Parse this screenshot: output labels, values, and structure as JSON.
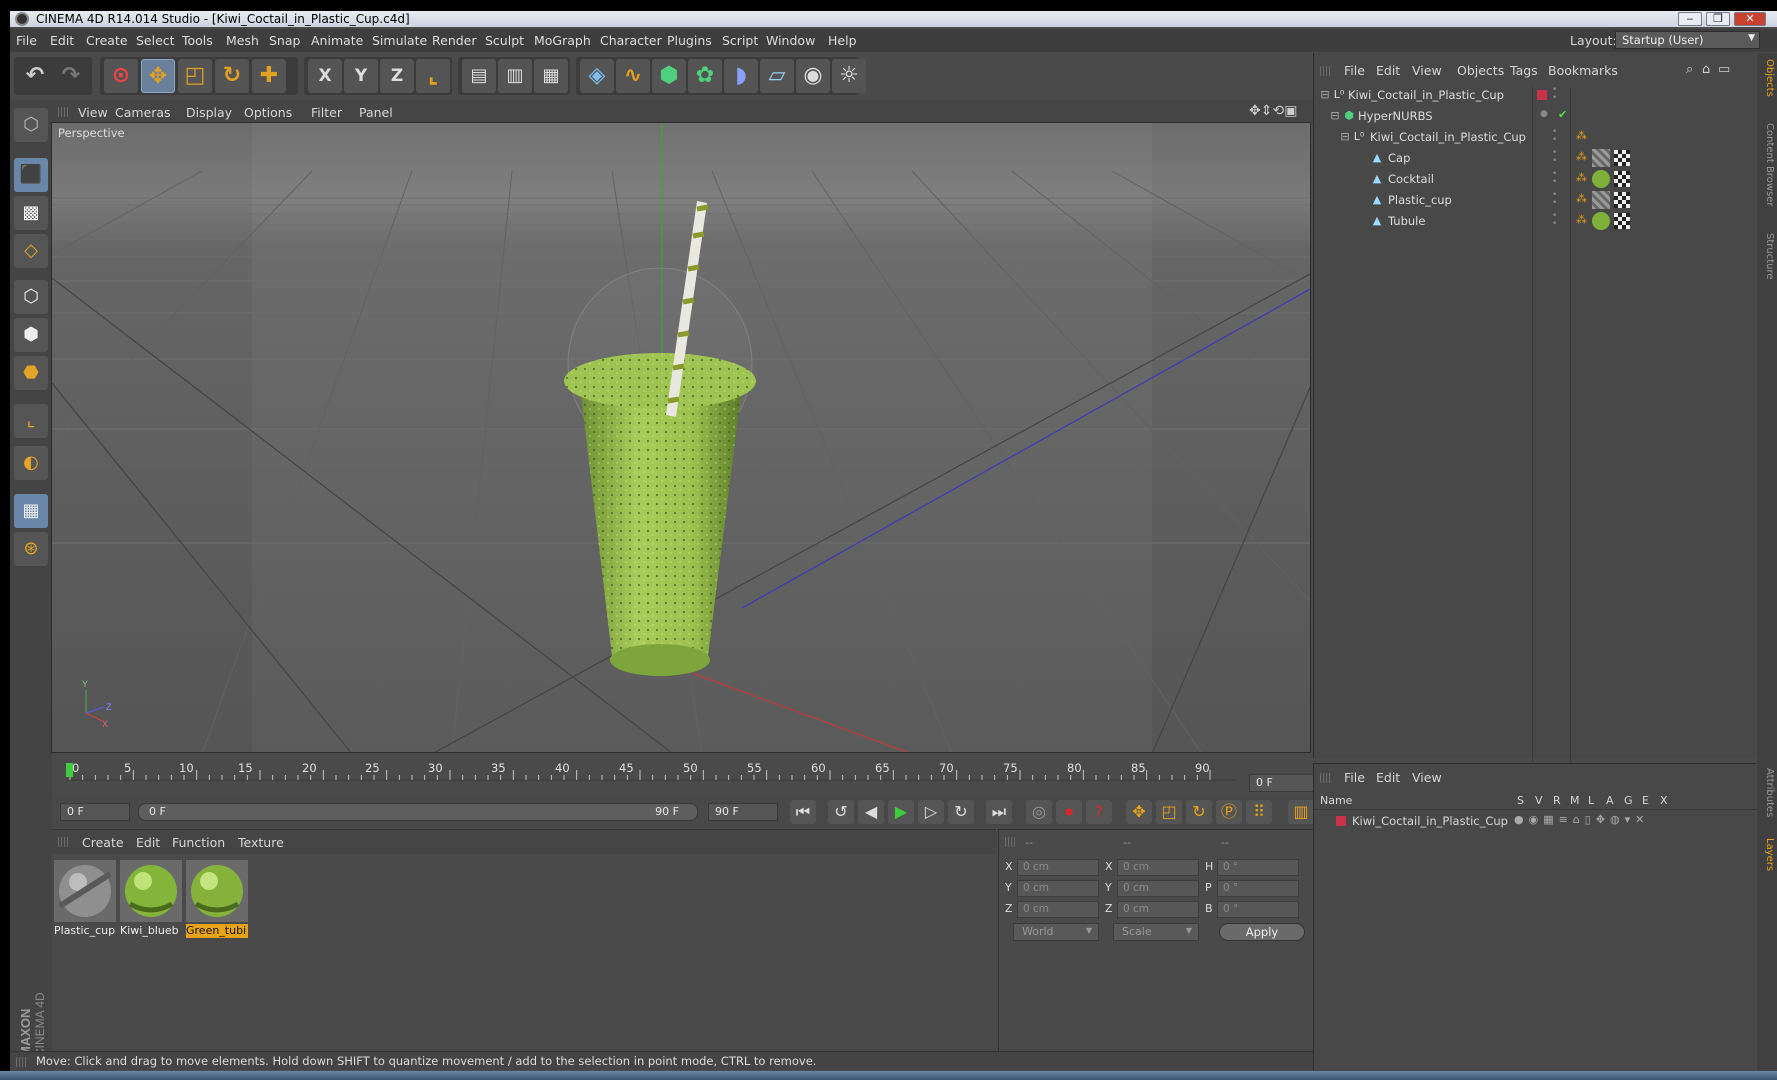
{
  "window": {
    "title": "CINEMA 4D R14.014 Studio - [Kiwi_Coctail_in_Plastic_Cup.c4d]",
    "minimize": "‒",
    "restore": "❐",
    "close": "✕"
  },
  "menubar": {
    "items": [
      "File",
      "Edit",
      "Create",
      "Select",
      "Tools",
      "Mesh",
      "Snap",
      "Animate",
      "Simulate",
      "Render",
      "Sculpt",
      "MoGraph",
      "Character",
      "Plugins",
      "Script",
      "Window",
      "Help"
    ],
    "layout_label": "Layout:",
    "layout_value": "Startup (User)"
  },
  "toolbar": {
    "undo_icon": "undo-icon",
    "redo_icon": "redo-icon",
    "axis_x": "X",
    "axis_y": "Y",
    "axis_z": "Z"
  },
  "viewport": {
    "menu": [
      "View",
      "Cameras",
      "Display",
      "Options",
      "Filter",
      "Panel"
    ],
    "label": "Perspective",
    "axis_y": "Y",
    "axis_z": "Z",
    "axis_x": "X"
  },
  "timeline": {
    "ticks": [
      "0",
      "5",
      "10",
      "15",
      "20",
      "25",
      "30",
      "35",
      "40",
      "45",
      "50",
      "55",
      "60",
      "65",
      "70",
      "75",
      "80",
      "85",
      "90"
    ],
    "current_frame": "0 F",
    "start_frame": "0 F",
    "range_start": "0 F",
    "range_end": "90 F",
    "end_frame": "90 F"
  },
  "material_manager": {
    "menu": [
      "Create",
      "Edit",
      "Function",
      "Texture"
    ],
    "materials": [
      {
        "name": "Plastic_cup",
        "selected": false
      },
      {
        "name": "Kiwi_blueb",
        "selected": false
      },
      {
        "name": "Green_tubi",
        "selected": true
      }
    ]
  },
  "coordinates": {
    "header_a": "--",
    "header_b": "--",
    "header_c": "--",
    "rows": [
      {
        "l1": "X",
        "v1": "0 cm",
        "l2": "X",
        "v2": "0 cm",
        "l3": "H",
        "v3": "0 °"
      },
      {
        "l1": "Y",
        "v1": "0 cm",
        "l2": "Y",
        "v2": "0 cm",
        "l3": "P",
        "v3": "0 °"
      },
      {
        "l1": "Z",
        "v1": "0 cm",
        "l2": "Z",
        "v2": "0 cm",
        "l3": "B",
        "v3": "0 °"
      }
    ],
    "world": "World",
    "scale": "Scale",
    "apply": "Apply"
  },
  "object_manager": {
    "menu": [
      "File",
      "Edit",
      "View",
      "Objects",
      "Tags",
      "Bookmarks"
    ],
    "objects": [
      {
        "name": "Kiwi_Coctail_in_Plastic_Cup",
        "indent": 0,
        "icon": "null-icon"
      },
      {
        "name": "HyperNURBS",
        "indent": 1,
        "icon": "hypernurbs-icon"
      },
      {
        "name": "Kiwi_Coctail_in_Plastic_Cup",
        "indent": 2,
        "icon": "null-icon"
      },
      {
        "name": "Cap",
        "indent": 3,
        "icon": "polygon-icon"
      },
      {
        "name": "Cocktail",
        "indent": 3,
        "icon": "polygon-icon"
      },
      {
        "name": "Plastic_cup",
        "indent": 3,
        "icon": "polygon-icon"
      },
      {
        "name": "Tubule",
        "indent": 3,
        "icon": "polygon-icon"
      }
    ]
  },
  "layer_manager": {
    "menu": [
      "File",
      "Edit",
      "View"
    ],
    "name_header": "Name",
    "columns": [
      "S",
      "V",
      "R",
      "M",
      "L",
      "A",
      "G",
      "E",
      "X"
    ],
    "layers": [
      {
        "name": "Kiwi_Coctail_in_Plastic_Cup",
        "color": "#c8324a"
      }
    ]
  },
  "side_tabs": {
    "top": [
      "Objects",
      "Content Browser",
      "Structure"
    ],
    "bottom": [
      "Attributes",
      "Layers"
    ]
  },
  "branding": "MAXON CINEMA 4D",
  "status": "Move: Click and drag to move elements. Hold down SHIFT to quantize movement / add to the selection in point mode, CTRL to remove.",
  "colors": {
    "accent": "#e8a318",
    "selection": "#6a86a8",
    "play": "#3dcc3d",
    "record": "#d42a2a"
  }
}
